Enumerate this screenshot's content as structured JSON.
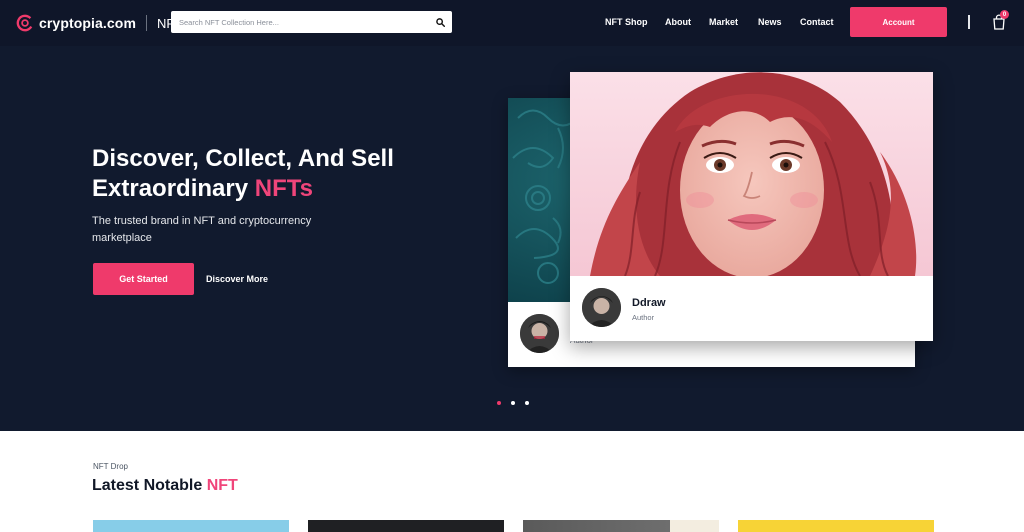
{
  "brand": {
    "name": "cryptopia.com",
    "section": "NFT",
    "accent_color": "#ef3a6b",
    "dark_bg": "#111a2e"
  },
  "search": {
    "placeholder": "Search NFT Collection Here...",
    "icon": "search-icon"
  },
  "nav": {
    "items": [
      {
        "label": "NFT Shop"
      },
      {
        "label": "About"
      },
      {
        "label": "Market"
      },
      {
        "label": "News"
      },
      {
        "label": "Contact"
      }
    ],
    "account_label": "Account",
    "cart_icon": "shopping-bag-icon",
    "cart_count": "0"
  },
  "hero": {
    "title_line1": "Discover, Collect, And Sell",
    "title_line2": "Extraordinary ",
    "title_accent": "NFTs",
    "subtitle": "The trusted brand in NFT and cryptocurrency marketplace",
    "primary_button": "Get Started",
    "secondary_link": "Discover More"
  },
  "cards": {
    "front": {
      "name": "Ddraw",
      "role": "Author"
    },
    "back": {
      "role": "Author"
    }
  },
  "carousel": {
    "slide_count": 3,
    "active_index": 1
  },
  "section": {
    "kicker": "NFT Drop",
    "title_plain": "Latest Notable ",
    "title_accent": "NFT"
  }
}
